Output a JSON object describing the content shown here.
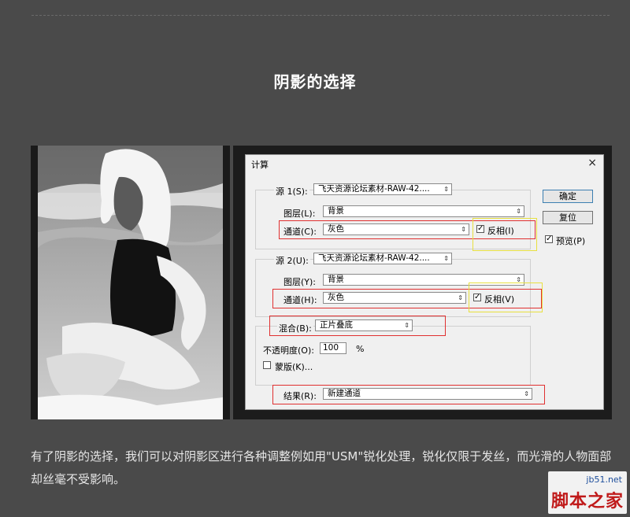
{
  "section_title": "阴影的选择",
  "dialog": {
    "title": "计算",
    "close_glyph": "×",
    "source1": {
      "label": "源 1(S):",
      "file": "飞天资源论坛素材-RAW-42....",
      "layer_label": "图层(L):",
      "layer_value": "背景",
      "channel_label": "通道(C):",
      "channel_value": "灰色",
      "invert_label": "反相(I)",
      "invert_checked": true
    },
    "source2": {
      "label": "源 2(U):",
      "file": "飞天资源论坛素材-RAW-42....",
      "layer_label": "图层(Y):",
      "layer_value": "背景",
      "channel_label": "通道(H):",
      "channel_value": "灰色",
      "invert_label": "反相(V)",
      "invert_checked": true
    },
    "blending_label": "混合(B):",
    "blending_value": "正片叠底",
    "opacity_label": "不透明度(O):",
    "opacity_value": "100",
    "opacity_unit": "%",
    "mask_label": "蒙版(K)...",
    "mask_checked": false,
    "result_label": "结果(R):",
    "result_value": "新建通道",
    "ok_label": "确定",
    "reset_label": "复位",
    "preview_label": "预览(P)",
    "preview_checked": true,
    "check_glyph": "✓",
    "arrow_glyph": "⇕"
  },
  "caption": "有了阴影的选择，我们可以对阴影区进行各种调整例如用\"USM\"锐化处理，锐化仅限于发丝，而光滑的人物面部却丝毫不受影响。",
  "watermark": {
    "url": "jb51.net",
    "name": "脚本之家"
  },
  "colors": {
    "page_bg": "#4a4a4a",
    "highlight_red": "#e03030",
    "highlight_yellow": "#e8e040"
  }
}
